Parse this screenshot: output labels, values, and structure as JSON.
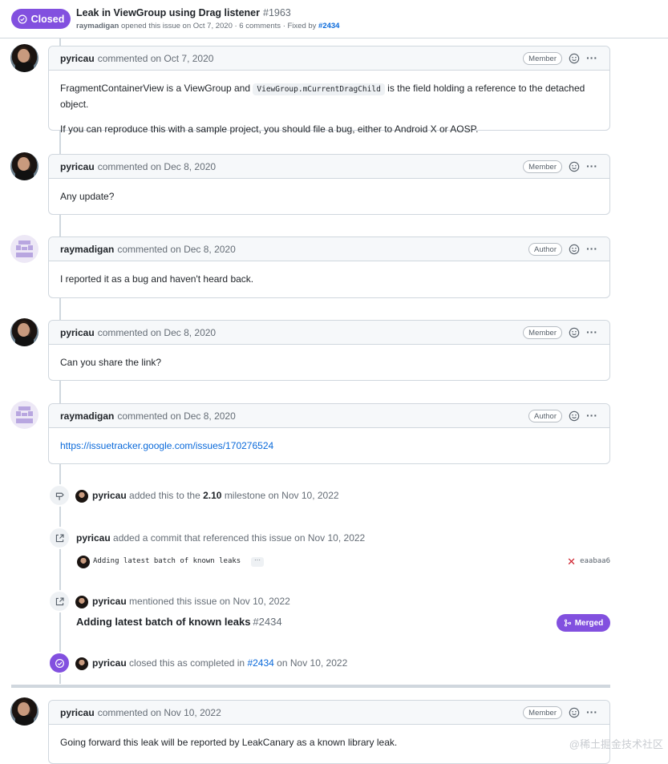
{
  "issue": {
    "state": "Closed",
    "title": "Leak in ViewGroup using Drag listener",
    "number": "#1963",
    "author": "raymadigan",
    "opened_text": "opened this issue on Oct 7, 2020 · 6 comments · Fixed by",
    "fixed_by": "#2434"
  },
  "comments": [
    {
      "author": "pyricau",
      "action": "commented on Oct 7, 2020",
      "role": "Member",
      "body_p1_before": "FragmentContainerView is a ViewGroup and",
      "body_p1_code": "ViewGroup.mCurrentDragChild",
      "body_p1_after": "is the field holding a reference to the detached object.",
      "body_p2": "If you can reproduce this with a sample project, you should file a bug, either to Android X or AOSP."
    },
    {
      "author": "pyricau",
      "action": "commented on Dec 8, 2020",
      "role": "Member",
      "body": "Any update?"
    },
    {
      "author": "raymadigan",
      "action": "commented on Dec 8, 2020",
      "role": "Author",
      "body": "I reported it as a bug and haven't heard back."
    },
    {
      "author": "pyricau",
      "action": "commented on Dec 8, 2020",
      "role": "Member",
      "body": "Can you share the link?"
    },
    {
      "author": "raymadigan",
      "action": "commented on Dec 8, 2020",
      "role": "Author",
      "link": "https://issuetracker.google.com/issues/170276524"
    },
    {
      "author": "pyricau",
      "action": "commented on Nov 10, 2022",
      "role": "Member",
      "body": "Going forward this leak will be reported by LeakCanary as a known library leak."
    }
  ],
  "events": {
    "milestone": {
      "actor": "pyricau",
      "text_before": "added this to the",
      "milestone": "2.10",
      "text_after": "milestone on Nov 10, 2022"
    },
    "commit_ref": {
      "actor": "pyricau",
      "text": "added a commit that referenced this issue on Nov 10, 2022"
    },
    "commit": {
      "message": "Adding latest batch of known leaks",
      "ellipsis": "···",
      "sha": "eaabaa6",
      "status": "✕"
    },
    "mention": {
      "actor": "pyricau",
      "text": "mentioned this issue on Nov 10, 2022"
    },
    "pr": {
      "title": "Adding latest batch of known leaks",
      "number": "#2434",
      "state": "Merged"
    },
    "closed": {
      "actor": "pyricau",
      "text_before": "closed this as completed in",
      "pr_link": "#2434",
      "text_after": "on Nov 10, 2022"
    }
  },
  "more_label": "···",
  "watermark": "@稀土掘金技术社区",
  "colors": {
    "accent_purple": "#8250df",
    "link_blue": "#0969da",
    "border": "#d0d7de",
    "header_bg": "#f6f8fa"
  }
}
